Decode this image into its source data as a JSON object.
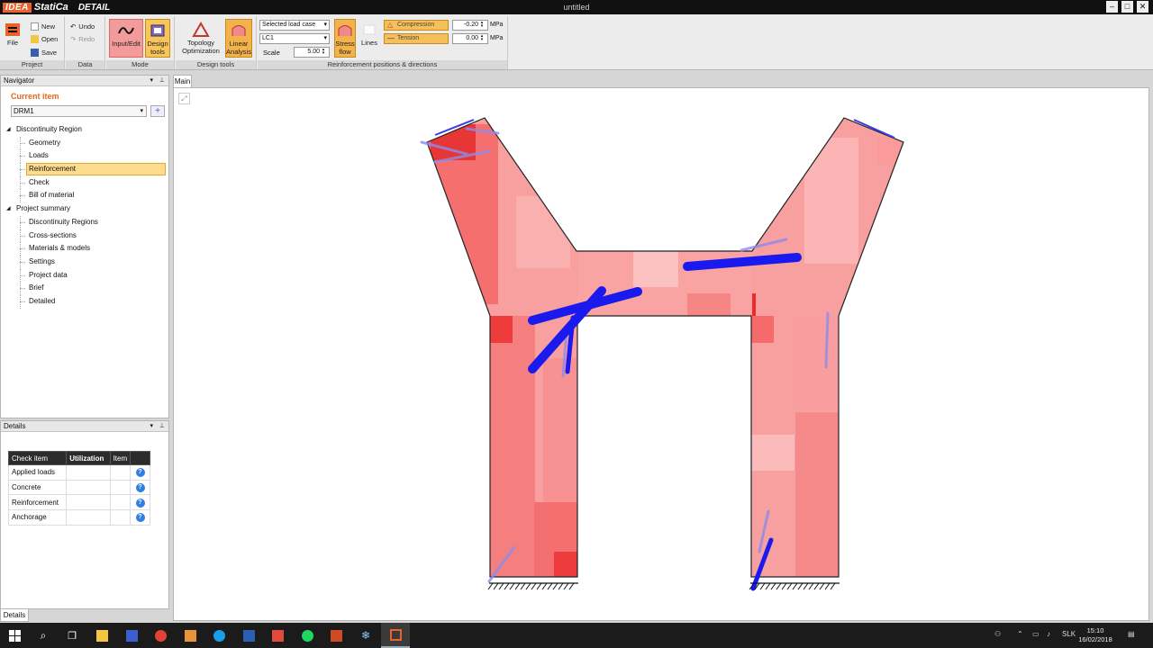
{
  "app": {
    "logo_idea": "IDEA",
    "logo_statica": "StatiCa",
    "product": "DETAIL",
    "title": "untitled"
  },
  "window": {
    "minimize": "–",
    "maximize": "□",
    "close": "✕"
  },
  "ribbon": {
    "file": "File",
    "new": "New",
    "open": "Open",
    "save": "Save",
    "undo": "Undo",
    "redo": "Redo",
    "input_edit": "Input/Edit",
    "design_tools": "Design tools",
    "topology": "Topology Optimization",
    "linear": "Linear Analysis",
    "load_case_label": "Selected load case",
    "load_case": "LC1",
    "scale_label": "Scale",
    "scale_value": "5.00",
    "stress_flow": "Stress flow",
    "lines": "Lines",
    "compression": "Compression",
    "tension": "Tension",
    "compression_value": "-0.20",
    "tension_value": "0.00",
    "unit1": "MPa",
    "unit2": "MPa",
    "groups": {
      "project": "Project",
      "data": "Data",
      "mode": "Mode",
      "design": "Design tools",
      "reinf": "Reinforcement positions & directions"
    }
  },
  "navigator": {
    "header": "Navigator",
    "current_item": "Current item",
    "current_value": "DRM1",
    "tree": [
      {
        "label": "Discontinuity Region",
        "level": 0
      },
      {
        "label": "Geometry",
        "level": 1
      },
      {
        "label": "Loads",
        "level": 1
      },
      {
        "label": "Reinforcement",
        "level": 1,
        "selected": true
      },
      {
        "label": "Check",
        "level": 1
      },
      {
        "label": "Bill of material",
        "level": 1
      },
      {
        "label": "Project summary",
        "level": 0
      },
      {
        "label": "Discontinuity Regions",
        "level": 1
      },
      {
        "label": "Cross-sections",
        "level": 1
      },
      {
        "label": "Materials & models",
        "level": 1
      },
      {
        "label": "Settings",
        "level": 1
      },
      {
        "label": "Project data",
        "level": 1
      },
      {
        "label": "Brief",
        "level": 1
      },
      {
        "label": "Detailed",
        "level": 1
      }
    ]
  },
  "details": {
    "header": "Details",
    "columns": [
      "Check item",
      "Utilization",
      "Item"
    ],
    "rows": [
      "Applied loads",
      "Concrete",
      "Reinforcement",
      "Anchorage"
    ],
    "tab": "Details"
  },
  "main_tab": "Main",
  "colors": {
    "accent": "#e06a1c",
    "selected": "#fddc8e",
    "tension_bar": "#1a1aee"
  },
  "taskbar": {
    "lang": "SLK",
    "time": "15:10",
    "date": "16/02/2018"
  }
}
